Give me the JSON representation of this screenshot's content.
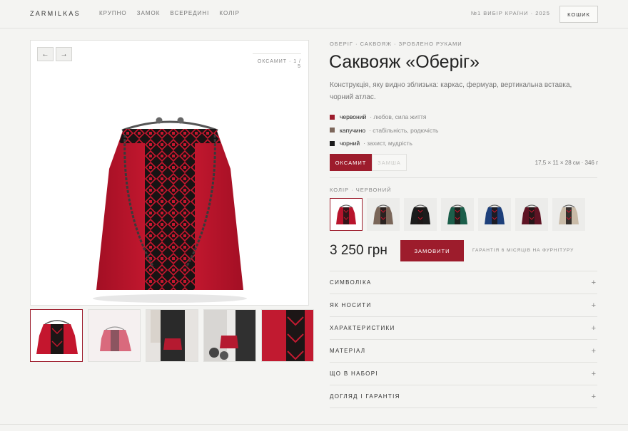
{
  "header": {
    "logo": "ZARMILKAS",
    "nav": [
      "КРУПНО",
      "ЗАМОК",
      "ВСЕРЕДИНІ",
      "КОЛІР"
    ],
    "badge": "№1 ВИБІР КРАЇНИ · 2025",
    "cart_label": "КОШИК"
  },
  "gallery": {
    "prev_icon": "arrow-left-icon",
    "next_icon": "arrow-right-icon",
    "prev_glyph": "←",
    "next_glyph": "→",
    "counter": "ОКСАМИТ · 1 / 5",
    "thumbnail_count": 5,
    "active_thumbnail": 1
  },
  "product": {
    "breadcrumb": "ОБЕРІГ · САКВОЯЖ · ЗРОБЛЕНО РУКАМИ",
    "title": "Саквояж «Оберіг»",
    "description": "Конструкція, яку видно зблизька: каркас, фермуар, вертикальна вставка, чорний атлас.",
    "legend": [
      {
        "color": "#9d1c2c",
        "name": "червоний",
        "meaning": "· любов, сила життя"
      },
      {
        "color": "#7d675b",
        "name": "капучино",
        "meaning": "· стабільність, родючість"
      },
      {
        "color": "#1b1b1b",
        "name": "чорний",
        "meaning": "· захист, мудрість"
      }
    ],
    "materials": [
      "ОКСАМИТ",
      "ЗАМША"
    ],
    "selected_material": "ОКСАМИТ",
    "dimensions": "17,5 × 11 × 28 см · 346 г",
    "color_label": "КОЛІР · ЧЕРВОНИЙ",
    "swatches": [
      {
        "body": "#b8142c",
        "active": true
      },
      {
        "body": "#7a6659",
        "active": false
      },
      {
        "body": "#1c1c1c",
        "active": false
      },
      {
        "body": "#1b5e4a",
        "active": false
      },
      {
        "body": "#1d3f7a",
        "active": false
      },
      {
        "body": "#5e1424",
        "active": false
      },
      {
        "body": "#c9bba8",
        "active": false
      }
    ],
    "price": "3 250 грн",
    "order_label": "ЗАМОВИТИ",
    "warranty": "ГАРАНТІЯ 6 МІСЯЦІВ НА ФУРНІТУРУ"
  },
  "accordion": {
    "items": [
      "СИМВОЛІКА",
      "ЯК НОСИТИ",
      "ХАРАКТЕРИСТИКИ",
      "МАТЕРІАЛ",
      "ЩО В НАБОРІ",
      "ДОГЛЯД І ГАРАНТІЯ"
    ],
    "expand_glyph": "+"
  },
  "colors": {
    "accent": "#9d1c2c",
    "background": "#f4f4f2"
  }
}
